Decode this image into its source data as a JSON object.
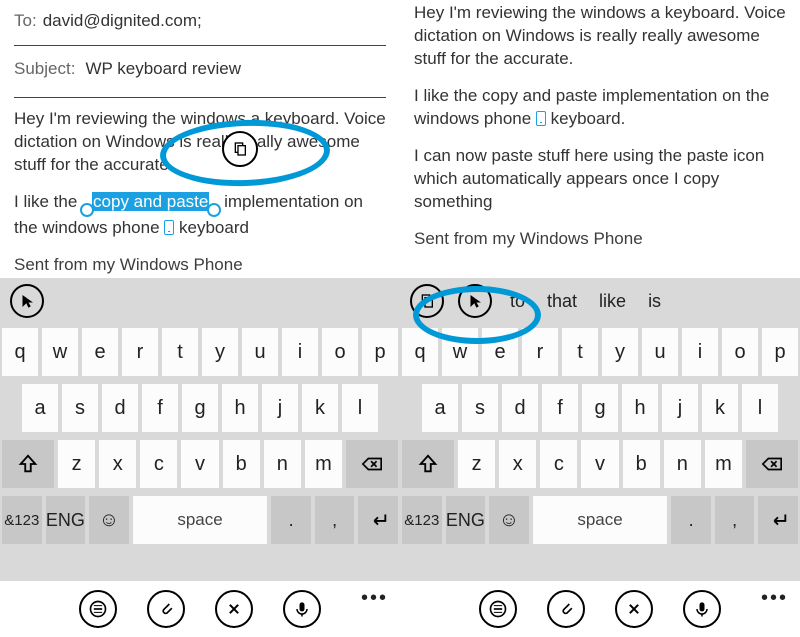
{
  "left": {
    "to_label": "To:",
    "to_value": "david@dignited.com;",
    "subject_label": "Subject:",
    "subject_value": "WP keyboard review",
    "body_p1_a": "Hey I'm reviewing the windows a keyboard. Voice dictation on Windows is really really awesome stuff for the accurate.",
    "body_p2_a": "I like the ",
    "body_p2_sel": "copy and paste",
    "body_p2_b": " implementation on the windows phone ",
    "body_p2_c": " keyboard",
    "signature": "Sent from my Windows Phone"
  },
  "right": {
    "body_p1": "Hey I'm reviewing the windows a keyboard. Voice dictation on Windows is really really awesome stuff for the accurate.",
    "body_p2_a": "I like the copy and paste implementation on the windows phone ",
    "body_p2_b": " keyboard.",
    "body_p3": "I can now paste stuff here using the paste icon which automatically appears once I copy something",
    "signature": "Sent from my Windows Phone",
    "suggestions": {
      "s1": "to",
      "s2": "that",
      "s3": "like",
      "s4": "is"
    }
  },
  "keyboard": {
    "row1": [
      "q",
      "w",
      "e",
      "r",
      "t",
      "y",
      "u",
      "i",
      "o",
      "p"
    ],
    "row2": [
      "a",
      "s",
      "d",
      "f",
      "g",
      "h",
      "j",
      "k",
      "l"
    ],
    "row3_mid": [
      "z",
      "x",
      "c",
      "v",
      "b",
      "n",
      "m"
    ],
    "sym": "&123",
    "eng": "ENG",
    "space": "space",
    "dot": ".",
    "comma": ","
  },
  "icons": {
    "cursor": "cursor-icon",
    "paste": "paste-icon",
    "copy": "copy-icon",
    "shift": "shift-icon",
    "backspace": "backspace-icon",
    "emoji": "emoji-icon",
    "enter": "enter-icon",
    "send": "send-icon",
    "attach": "attach-icon",
    "close": "close-icon",
    "mic": "mic-icon",
    "more": "more-icon"
  },
  "colors": {
    "accent": "#1ba1e2",
    "annotation": "#0099d8",
    "kbd_bg": "#d9d9d9"
  }
}
